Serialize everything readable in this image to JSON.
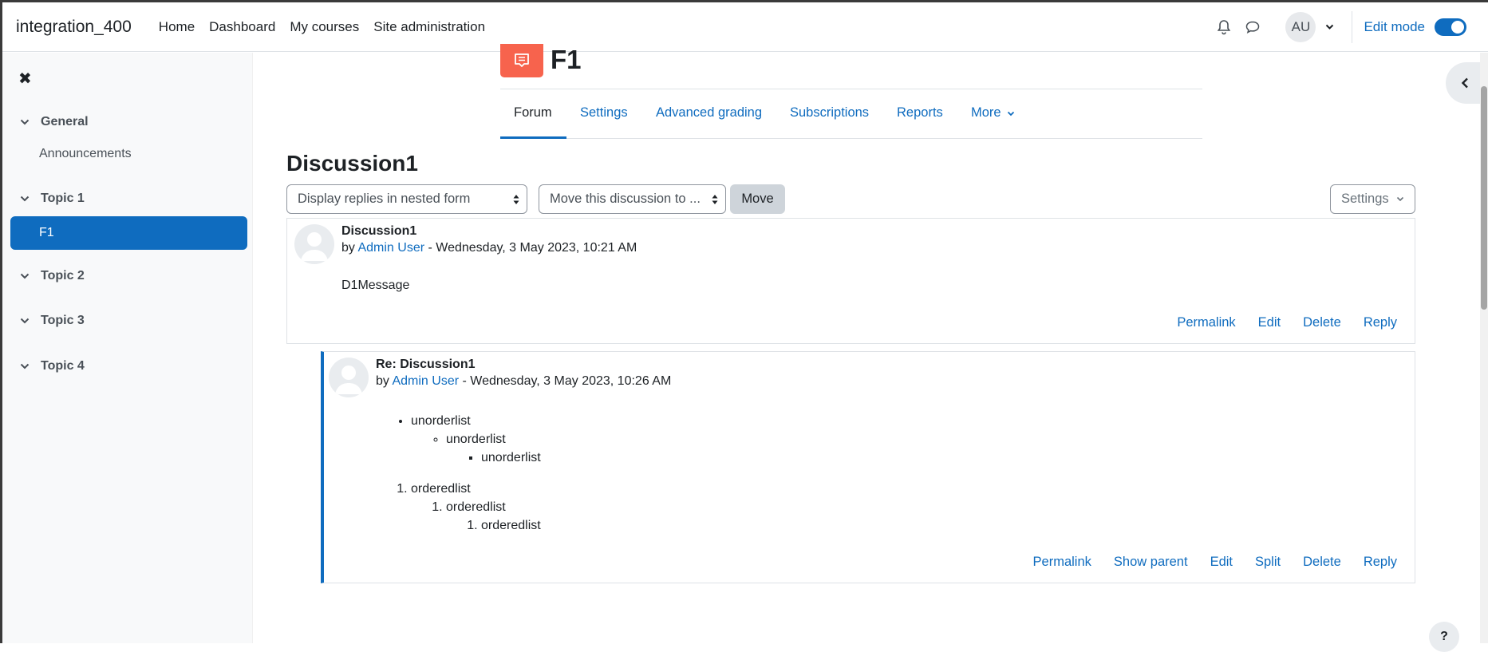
{
  "navbar": {
    "brand": "integration_400",
    "links": [
      "Home",
      "Dashboard",
      "My courses",
      "Site administration"
    ],
    "avatar_initials": "AU",
    "edit_mode_label": "Edit mode",
    "edit_mode_on": true
  },
  "course_index": {
    "sections": [
      {
        "title": "General",
        "items": [
          "Announcements"
        ]
      },
      {
        "title": "Topic 1",
        "items": [
          "F1"
        ]
      },
      {
        "title": "Topic 2",
        "items": []
      },
      {
        "title": "Topic 3",
        "items": []
      },
      {
        "title": "Topic 4",
        "items": []
      }
    ],
    "active_item": "F1"
  },
  "activity": {
    "title": "F1",
    "icon": "forum-icon",
    "icon_color": "#f7634d",
    "tabs": [
      "Forum",
      "Settings",
      "Advanced grading",
      "Subscriptions",
      "Reports",
      "More"
    ],
    "active_tab": "Forum"
  },
  "discussion": {
    "title": "Discussion1",
    "display_mode": "Display replies in nested form",
    "move_select": "Move this discussion to ...",
    "move_button": "Move",
    "settings_button": "Settings"
  },
  "posts": [
    {
      "subject": "Discussion1",
      "by": "by",
      "author": "Admin User",
      "date": "- Wednesday, 3 May 2023, 10:21 AM",
      "message": "D1Message",
      "actions": [
        "Permalink",
        "Edit",
        "Delete",
        "Reply"
      ]
    },
    {
      "subject": "Re: Discussion1",
      "by": "by",
      "author": "Admin User",
      "date": "- Wednesday, 3 May 2023, 10:26 AM",
      "unordered": [
        "unorderlist",
        "unorderlist",
        "unorderlist"
      ],
      "ordered": [
        "orderedlist",
        "orderedlist",
        "orderedlist"
      ],
      "actions": [
        "Permalink",
        "Show parent",
        "Edit",
        "Split",
        "Delete",
        "Reply"
      ]
    }
  ],
  "help_button": "?",
  "colors": {
    "accent": "#0f6cbf",
    "text": "#1d2125",
    "drawer_bg": "#f8f9fa"
  }
}
